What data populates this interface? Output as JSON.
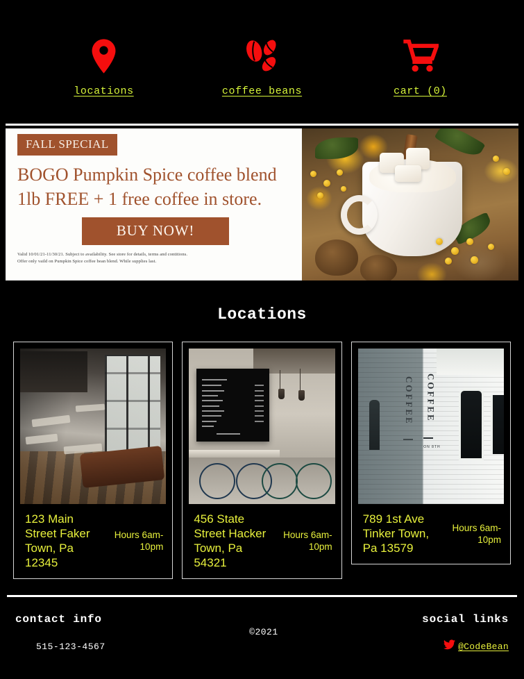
{
  "site": {
    "accent_red": "#f50e0e",
    "accent_yellow": "#d7f53a",
    "banner_brown": "#a0522d",
    "background": "#000000"
  },
  "nav": {
    "items": [
      {
        "label": "locations",
        "icon": "map-pin-icon"
      },
      {
        "label": "coffee beans",
        "icon": "coffee-beans-icon"
      },
      {
        "label": "cart (0)",
        "icon": "shopping-cart-icon"
      }
    ]
  },
  "banner": {
    "badge": "FALL SPECIAL",
    "headline": "BOGO Pumpkin Spice coffee blend 1lb FREE + 1 free coffee in store.",
    "button": "BUY NOW!",
    "fineprint_line1": "Valid 10/01/21-11/30/21. Subject to availability. See store for details, terms and contitions.",
    "fineprint_line2": "Offer only vaild on Pumpkin Spice coffee bean blend. While supplies last.",
    "image_alt": "pumpkin-spice-latte-photo"
  },
  "locations": {
    "title": "Locations",
    "cards": [
      {
        "address": "123 Main Street Faker Town, Pa 12345",
        "hours": "Hours 6am-10pm",
        "image_alt": "cafe-interior-photo"
      },
      {
        "address": "456 State Street Hacker Town, Pa 54321",
        "hours": "Hours 6am-10pm",
        "image_alt": "menu-board-bikes-photo"
      },
      {
        "address": "789 1st Ave Tinker Town, Pa 13579",
        "hours": "Hours 6am-10pm",
        "image_alt": "coffee-brick-wall-photo"
      }
    ]
  },
  "footer": {
    "contact_heading": "contact info",
    "phone": "515-123-4567",
    "copyright": "©2021",
    "social_heading": "social links",
    "social_handle": "@CodeBean",
    "social_icon": "twitter-icon"
  },
  "brick_photo": {
    "word": "COFFEE",
    "subtext": "ON 8TH"
  }
}
